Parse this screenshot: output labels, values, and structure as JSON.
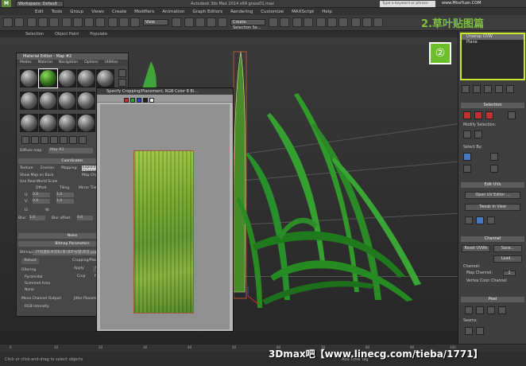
{
  "titlebar": {
    "workspace": "Workspace: Default",
    "title": "Autodesk 3ds Max 2014 x64     grass01.max",
    "search_placeholder": "Type a keyword or phrase",
    "watermark": "www.MissYuan.COM"
  },
  "menus": [
    "Edit",
    "Tools",
    "Group",
    "Views",
    "Create",
    "Modifiers",
    "Animation",
    "Graph Editors",
    "Rendering",
    "Customize",
    "MAXScript",
    "Help"
  ],
  "toolbar": {
    "view_label": "View",
    "selection_set": "Create Selection Se..."
  },
  "brand_text": "2.草叶贴图篇",
  "ribbon_tabs": [
    "Selection",
    "Object Paint",
    "Populate"
  ],
  "step_badge": "②",
  "material_editor": {
    "title": "Material Editor - Map #2",
    "menus": [
      "Modes",
      "Material",
      "Navigation",
      "Options",
      "Utilities"
    ],
    "map_label": "Diffuse map:",
    "map_value": "Map #2",
    "coord_title": "Coordinates",
    "texture_opt": "Texture",
    "environ_opt": "Environ",
    "mapping_label": "Mapping:",
    "mapping_value": "Explicit Map Channel",
    "show_map_back": "Show Map on Back",
    "map_channel": "Map Channel",
    "real_world": "Use Real-World Scale",
    "offset": "Offset",
    "tiling": "Tiling",
    "mirror_tile": "Mirror Tile",
    "angle": "Angle",
    "u": "U:",
    "v": "V:",
    "w": "W:",
    "u_offset": "0.0",
    "v_offset": "0.0",
    "u_tiling": "1.0",
    "v_tiling": "1.0",
    "blur": "Blur:",
    "blur_val": "1.0",
    "blur_offset": "Blur offset:",
    "blur_offset_val": "0.0",
    "noise_title": "Noise",
    "bitmap_params_title": "Bitmap Parameters",
    "bitmap_label": "Bitmap:",
    "bitmap_path": "...叶创建技术资料\\草\\草叶纹理\\草茎.jpg",
    "reload": "Reload",
    "cropping": "Cropping/Placement",
    "apply": "Apply",
    "view_image": "View Image",
    "crop": "Crop",
    "place": "Place",
    "filtering": "Filtering",
    "pyramidal": "Pyramidal",
    "summed_area": "Summed Area",
    "none": "None",
    "mono_out": "Mono Channel Output:",
    "rgb_intensity": "RGB Intensity",
    "jitter": "Jitter Placement"
  },
  "crop_dialog": {
    "title": "Specify Cropping/Placement, RGB Color 8 Bi..."
  },
  "modifier_stack": {
    "items": [
      "Unwrap UVW",
      "Plane"
    ],
    "selected_index": 0
  },
  "command_panel": {
    "selection_title": "Selection",
    "modify_selection": "Modify Selection:",
    "select_by": "Select By:",
    "edit_uvs_title": "Edit UVs",
    "open_uv_editor": "Open UV Editor ...",
    "tweak_in_view": "Tweak In View",
    "channel_title": "Channel",
    "reset_uvws": "Reset UVWs",
    "save": "Save...",
    "load": "Load...",
    "channel_label": "Channel:",
    "map_channel": "Map Channel:",
    "map_channel_value": "1",
    "vertex_color_channel": "Vertex Color Channel",
    "peel_title": "Peel",
    "seams": "Seams:"
  },
  "timeline": {
    "ticks": [
      "0",
      "10",
      "20",
      "30",
      "40",
      "50",
      "60",
      "70",
      "80",
      "90",
      "100"
    ]
  },
  "statusbar": {
    "status": "Click or click-and-drag to select objects",
    "add_time_tag": "Add Time Tag"
  },
  "bottom_watermark": "3Dmax吧【www.linecg.com/tieba/1771】",
  "colors": {
    "accent_green": "#7fc040",
    "highlight": "#cfe82a"
  }
}
